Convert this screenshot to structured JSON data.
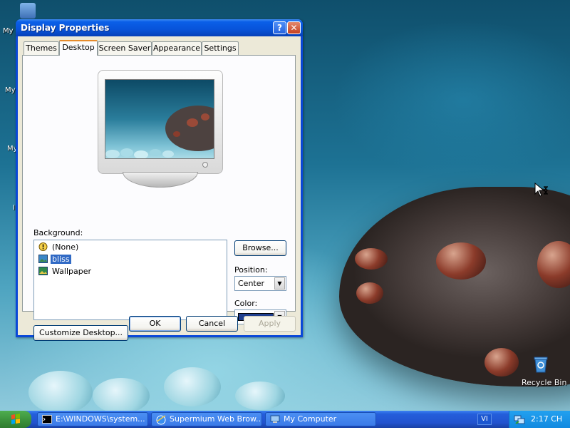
{
  "desktop": {
    "icons": [
      {
        "name": "my-documents",
        "label": "My"
      },
      {
        "name": "my-computer",
        "label": "My"
      },
      {
        "name": "my-network",
        "label": "My"
      },
      {
        "name": "internet",
        "label": "I"
      },
      {
        "name": "recycle-bin",
        "label": "Recycle Bin"
      }
    ]
  },
  "window": {
    "title": "Display Properties",
    "help_glyph": "?",
    "close_glyph": "✕",
    "tabs": [
      "Themes",
      "Desktop",
      "Screen Saver",
      "Appearance",
      "Settings"
    ],
    "active_tab": "Desktop",
    "background_label": "Background:",
    "background_items": [
      {
        "label": "(None)",
        "icon": "none-icon",
        "selected": false
      },
      {
        "label": "bliss",
        "icon": "image-icon",
        "selected": true
      },
      {
        "label": "Wallpaper",
        "icon": "image-icon",
        "selected": false
      }
    ],
    "browse_button": "Browse...",
    "position_label": "Position:",
    "position_value": "Center",
    "color_label": "Color:",
    "color_value": "#1f3f8f",
    "customize_button": "Customize Desktop...",
    "ok_button": "OK",
    "cancel_button": "Cancel",
    "apply_button": "Apply"
  },
  "taskbar": {
    "tasks": [
      {
        "label": "E:\\WINDOWS\\system...",
        "icon": "cmd-icon"
      },
      {
        "label": "Supermium Web Brow...",
        "icon": "browser-icon"
      },
      {
        "label": "My Computer",
        "icon": "computer-icon"
      }
    ],
    "language": "VI",
    "clock": "2:17 CH"
  },
  "colors": {
    "title_bar": "#0853d9",
    "dialog_face": "#ece9d8",
    "selection": "#316ac5",
    "tab_accent": "#e68b2c",
    "taskbar": "#245edb",
    "tray": "#128ae0"
  }
}
